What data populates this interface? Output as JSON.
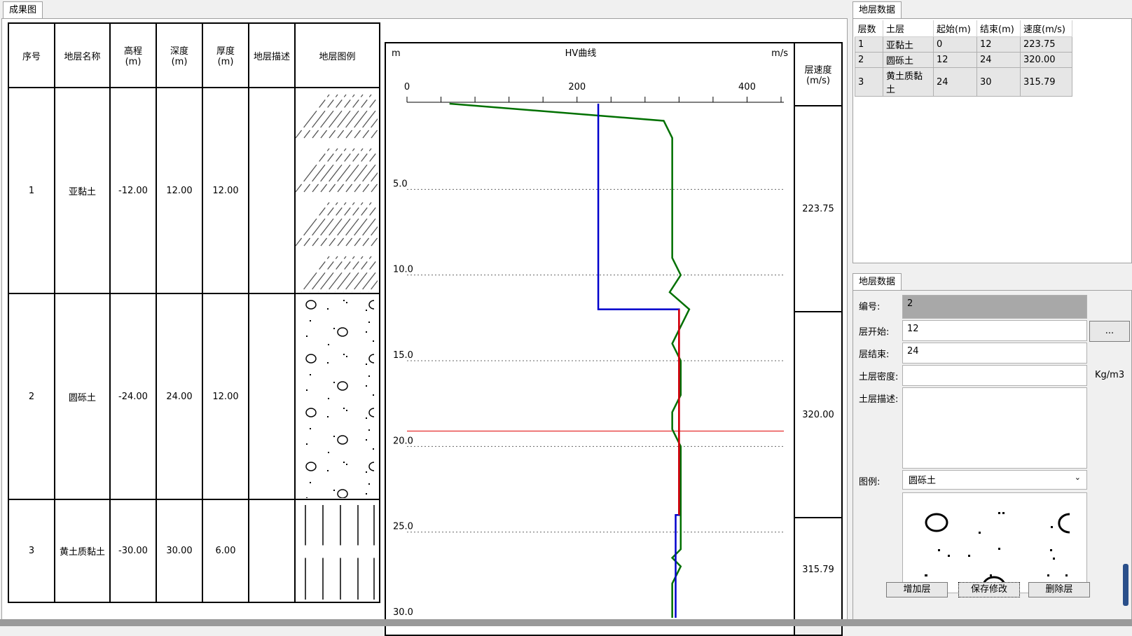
{
  "left_tab": "成果图",
  "table": {
    "headers": [
      "序号",
      "地层名称",
      "高程\n(m)",
      "深度\n(m)",
      "厚度\n(m)",
      "地层描述",
      "地层图例"
    ],
    "velocity_header": "层速度\n(m/s)",
    "rows": [
      {
        "no": "1",
        "name": "亚黏土",
        "elev": "-12.00",
        "depth": "12.00",
        "thick": "12.00",
        "desc": "",
        "velocity": "223.75",
        "pattern": "hatch"
      },
      {
        "no": "2",
        "name": "圆砾土",
        "elev": "-24.00",
        "depth": "24.00",
        "thick": "12.00",
        "desc": "",
        "velocity": "320.00",
        "pattern": "gravel"
      },
      {
        "no": "3",
        "name": "黄土质黏土",
        "elev": "-30.00",
        "depth": "30.00",
        "thick": "6.00",
        "desc": "",
        "velocity": "315.79",
        "pattern": "vertical"
      }
    ]
  },
  "chart_data": {
    "type": "line",
    "title": "HV曲线",
    "ylabel": "m",
    "xlabel": "m/s",
    "xlim": [
      0,
      440
    ],
    "ylim": [
      0,
      30
    ],
    "x_ticks": [
      "0",
      "200",
      "400"
    ],
    "y_ticks": [
      "5.0",
      "10.0",
      "15.0",
      "20.0",
      "25.0",
      "30.0"
    ],
    "grid": "dotted horizontal",
    "colors": {
      "green": "#007000",
      "blue": "#0000cc",
      "red": "#e00000"
    },
    "series": [
      {
        "color": "green",
        "points": [
          [
            50,
            0
          ],
          [
            302,
            1
          ],
          [
            312,
            2
          ],
          [
            312,
            9
          ],
          [
            322,
            10
          ],
          [
            309,
            11
          ],
          [
            332,
            12
          ],
          [
            312,
            14
          ],
          [
            322,
            15
          ],
          [
            322,
            17
          ],
          [
            312,
            18
          ],
          [
            312,
            19
          ],
          [
            322,
            20
          ],
          [
            322,
            24
          ],
          [
            322,
            26
          ],
          [
            312,
            26.5
          ],
          [
            322,
            27
          ],
          [
            312,
            28
          ],
          [
            312,
            30
          ]
        ]
      },
      {
        "color": "blue",
        "points": [
          [
            225,
            0
          ],
          [
            225,
            12
          ],
          [
            320,
            12
          ],
          [
            320,
            24
          ],
          [
            316,
            24
          ],
          [
            316,
            30
          ]
        ]
      },
      {
        "color": "red",
        "points": [
          [
            320,
            12
          ],
          [
            320,
            24
          ]
        ]
      }
    ],
    "cursor_depth": 19.1
  },
  "right_top": {
    "tab": "地层数据",
    "columns": [
      "层数",
      "土层",
      "起始(m)",
      "结束(m)",
      "速度(m/s)"
    ],
    "rows": [
      [
        "1",
        "亚黏土",
        "0",
        "12",
        "223.75"
      ],
      [
        "2",
        "圆砾土",
        "12",
        "24",
        "320.00"
      ],
      [
        "3",
        "黄土质黏土",
        "24",
        "30",
        "315.79"
      ]
    ]
  },
  "form": {
    "tab": "地层数据",
    "id_label": "编号:",
    "id_value": "2",
    "start_label": "层开始:",
    "start_value": "12",
    "end_label": "层结束:",
    "end_value": "24",
    "density_label": "土层密度:",
    "density_value": "",
    "density_unit": "Kg/m3",
    "desc_label": "土层描述:",
    "desc_value": "",
    "legend_label": "图例:",
    "legend_value": "圆砾土",
    "browse_label": "...",
    "add_label": "增加层",
    "save_label": "保存修改",
    "delete_label": "删除层"
  }
}
